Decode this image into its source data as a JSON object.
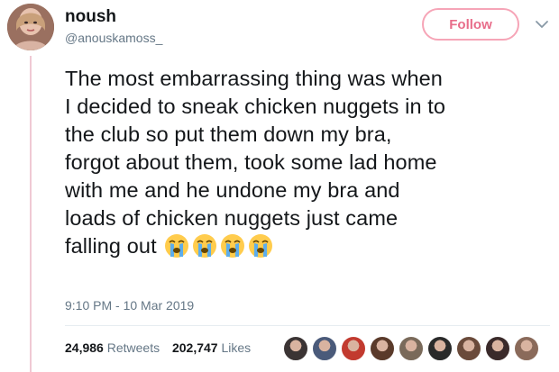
{
  "user": {
    "display_name": "noush",
    "handle": "@anouskamoss_"
  },
  "follow_button": {
    "label": "Follow",
    "color": "#e86d8a"
  },
  "tweet": {
    "lines": [
      "The most embarrassing thing was when",
      "I decided to sneak chicken nuggets in to",
      "the club so put them down my bra,",
      "forgot about them, took some lad home",
      "with me and he undone my bra and",
      "loads of chicken nuggets just came",
      "falling out"
    ],
    "emojis": [
      "loudly-crying-face",
      "loudly-crying-face",
      "loudly-crying-face",
      "loudly-crying-face"
    ],
    "timestamp": "9:10 PM - 10 Mar 2019"
  },
  "stats": {
    "retweets_count": "24,986",
    "retweets_label": "Retweets",
    "likes_count": "202,747",
    "likes_label": "Likes"
  },
  "likers": {
    "avatar_colors": [
      "#3b3434",
      "#4a5a7a",
      "#c23a2f",
      "#5a3a2a",
      "#7a6a5a",
      "#2a2a2a",
      "#6a4a3a",
      "#3a2a2a",
      "#8a6a5a"
    ]
  },
  "icons": {
    "chevron": "chevron-down-icon"
  }
}
